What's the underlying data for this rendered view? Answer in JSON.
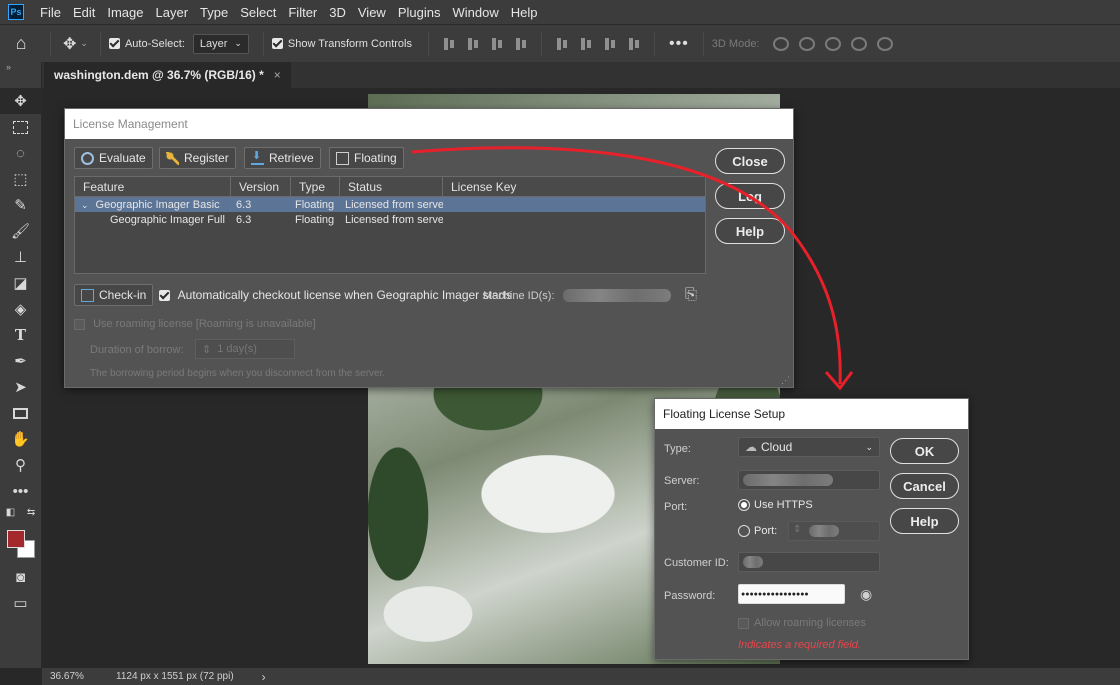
{
  "menubar": {
    "logo": "Ps",
    "items": [
      "File",
      "Edit",
      "Image",
      "Layer",
      "Type",
      "Select",
      "Filter",
      "3D",
      "View",
      "Plugins",
      "Window",
      "Help"
    ]
  },
  "options": {
    "auto_select_label": "Auto-Select:",
    "auto_select_checked": true,
    "layer_select": "Layer",
    "transform_controls_label": "Show Transform Controls",
    "transform_controls_checked": true,
    "mode_3d_label": "3D Mode:"
  },
  "document": {
    "tab_title": "washington.dem @ 36.7% (RGB/16) *",
    "tab_close": "×"
  },
  "license_dialog": {
    "title": "License Management",
    "buttons": {
      "evaluate": "Evaluate",
      "register": "Register",
      "retrieve": "Retrieve",
      "floating": "Floating"
    },
    "side_buttons": {
      "close": "Close",
      "log": "Log",
      "help": "Help"
    },
    "columns": [
      "Feature",
      "Version",
      "Type",
      "Status",
      "License Key"
    ],
    "rows": [
      {
        "feature": "Geographic Imager Basic",
        "version": "6.3",
        "type": "Floating",
        "status": "Licensed from server",
        "key": "",
        "expanded": true,
        "selected": true
      },
      {
        "feature": "Geographic Imager Full",
        "version": "6.3",
        "type": "Floating",
        "status": "Licensed from server",
        "key": "",
        "expanded": false,
        "selected": false
      }
    ],
    "checkin_button": "Check-in",
    "auto_checkout_label": "Automatically checkout license when Geographic Imager starts",
    "auto_checkout_checked": true,
    "machine_id_label": "Machine ID(s):",
    "roaming_label": "Use roaming license [Roaming is unavailable]",
    "borrow_label": "Duration of borrow:",
    "borrow_value": "1 day(s)",
    "borrow_note": "The borrowing period begins when you disconnect from the server."
  },
  "floating_dialog": {
    "title": "Floating License Setup",
    "type_label": "Type:",
    "type_value": "Cloud",
    "server_label": "Server:",
    "port_label": "Port:",
    "use_https_label": "Use HTTPS",
    "use_https_selected": true,
    "port_option_label": "Port:",
    "customer_id_label": "Customer ID:",
    "password_label": "Password:",
    "password_mask": "●●●●●●●●●●●●●●●●",
    "allow_roaming_label": "Allow roaming licenses",
    "required_note": "Indicates a required field.",
    "buttons": {
      "ok": "OK",
      "cancel": "Cancel",
      "help": "Help"
    }
  },
  "status": {
    "zoom": "36.67%",
    "doc_size": "1124 px x 1551 px (72 ppi)",
    "arrow": "›"
  },
  "colors": {
    "foreground_swatch": "#a4292c",
    "background_swatch": "#ffffff",
    "annotation_arrow": "#e8202a",
    "required_text": "#e8454c",
    "selected_row": "#5c7496"
  }
}
